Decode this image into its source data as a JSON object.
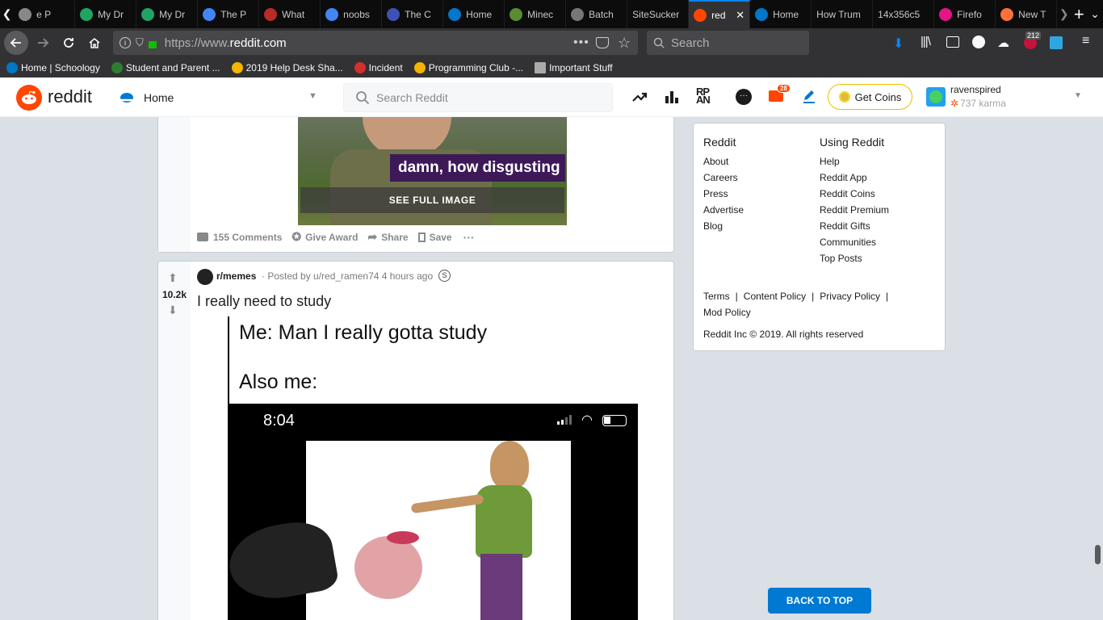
{
  "browser": {
    "tabs": [
      {
        "label": "e P",
        "icon": "generic-icon",
        "color": "#888"
      },
      {
        "label": "My Dr",
        "icon": "google-drive-icon",
        "color": "#1fa463"
      },
      {
        "label": "My Dr",
        "icon": "google-drive-icon",
        "color": "#1fa463"
      },
      {
        "label": "The P",
        "icon": "google-docs-icon",
        "color": "#4285f4"
      },
      {
        "label": "What",
        "icon": "quora-icon",
        "color": "#b92b27"
      },
      {
        "label": "noobs",
        "icon": "google-icon",
        "color": "#4285f4"
      },
      {
        "label": "The C",
        "icon": "globe-icon",
        "color": "#3f51b5"
      },
      {
        "label": "Home",
        "icon": "schoology-icon",
        "color": "#0077c8"
      },
      {
        "label": "Minec",
        "icon": "minecraft-icon",
        "color": "#5b8c32"
      },
      {
        "label": "Batch",
        "icon": "batch-icon",
        "color": "#777"
      },
      {
        "label": "SiteSucker",
        "icon": "",
        "color": ""
      },
      {
        "label": "red",
        "icon": "reddit-icon",
        "color": "#ff4500",
        "active": true
      },
      {
        "label": "Home",
        "icon": "schoology-icon",
        "color": "#0077c8"
      },
      {
        "label": "How Trum",
        "icon": "",
        "color": ""
      },
      {
        "label": "14x356c5",
        "icon": "",
        "color": ""
      },
      {
        "label": "Firefo",
        "icon": "firefox-monitor-icon",
        "color": "#e31587"
      },
      {
        "label": "New T",
        "icon": "firefox-icon",
        "color": "#ff7139"
      }
    ],
    "url_prefix": "https://www.",
    "url_domain": "reddit.com",
    "url_suffix": "",
    "search_placeholder": "Search",
    "download_badge": "212",
    "bookmarks": [
      {
        "label": "Home | Schoology",
        "icon": "schoology-icon"
      },
      {
        "label": "Student and Parent ...",
        "icon": "p-icon"
      },
      {
        "label": "2019 Help Desk Sha...",
        "icon": "google-drive-icon"
      },
      {
        "label": "Incident",
        "icon": "incident-icon"
      },
      {
        "label": "Programming Club -...",
        "icon": "google-drive-icon"
      },
      {
        "label": "Important Stuff",
        "icon": "folder-icon"
      }
    ]
  },
  "reddit": {
    "brand": "reddit",
    "home_label": "Home",
    "search_placeholder": "Search Reddit",
    "mail_badge": "28",
    "get_coins": "Get Coins",
    "username": "ravenspired",
    "karma": "737 karma"
  },
  "post1": {
    "image_caption": "damn, how disgusting",
    "see_full": "SEE FULL IMAGE",
    "comments": "155 Comments",
    "give_award": "Give Award",
    "share": "Share",
    "save": "Save",
    "more": "···"
  },
  "post2": {
    "subreddit": "r/memes",
    "posted_by": "· Posted by u/red_ramen74 4 hours ago",
    "votes": "10.2k",
    "title": "I really need to study",
    "meme_line1": "Me: Man I really gotta study",
    "meme_line2": "Also me:",
    "phone_time": "8:04"
  },
  "sidebar": {
    "col1_title": "Reddit",
    "col1_links": [
      "About",
      "Careers",
      "Press",
      "Advertise",
      "Blog"
    ],
    "col2_title": "Using Reddit",
    "col2_links": [
      "Help",
      "Reddit App",
      "Reddit Coins",
      "Reddit Premium",
      "Reddit Gifts",
      "Communities",
      "Top Posts"
    ],
    "terms": "Terms",
    "content_policy": "Content Policy",
    "privacy_policy": "Privacy Policy",
    "mod_policy": "Mod Policy",
    "copyright": "Reddit Inc © 2019. All rights reserved",
    "back_to_top": "BACK TO TOP"
  }
}
